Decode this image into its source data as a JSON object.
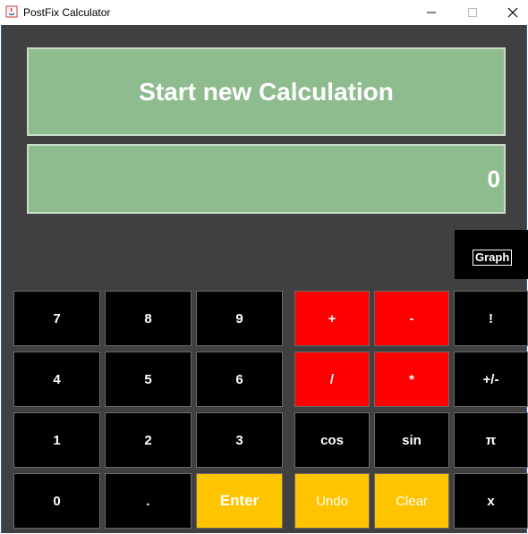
{
  "window": {
    "title": "PostFix Calculator"
  },
  "display": {
    "status": "Start new Calculation",
    "value": "0"
  },
  "graph_button": "Graph",
  "keys": {
    "k7": "7",
    "k8": "8",
    "k9": "9",
    "k4": "4",
    "k5": "5",
    "k6": "6",
    "k1": "1",
    "k2": "2",
    "k3": "3",
    "k0": "0",
    "dot": ".",
    "enter": "Enter",
    "plus": "+",
    "minus": "-",
    "fact": "!",
    "divide": "/",
    "multiply": "*",
    "negate": "+/-",
    "cos": "cos",
    "sin": "sin",
    "pi": "π",
    "undo": "Undo",
    "clear": "Clear",
    "x": "x"
  },
  "colors": {
    "background": "#404040",
    "display": "#8fbc8f",
    "digit_key": "#000000",
    "operator_key": "#ff0000",
    "action_key": "#ffc400"
  }
}
